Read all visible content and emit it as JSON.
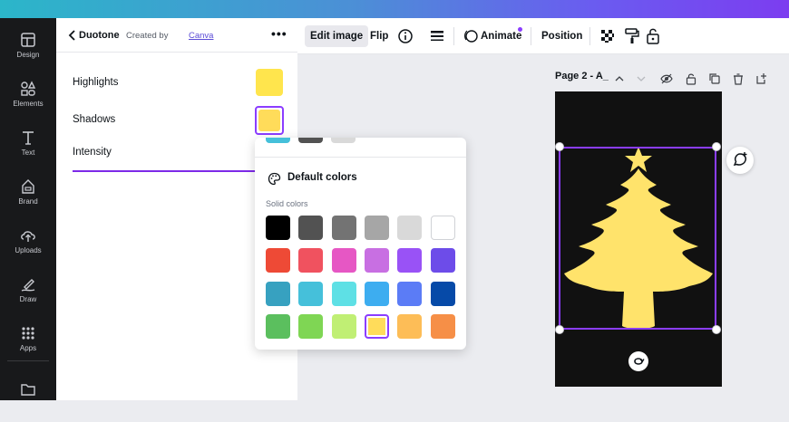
{
  "rail": {
    "items": [
      {
        "label": "Design"
      },
      {
        "label": "Elements"
      },
      {
        "label": "Text"
      },
      {
        "label": "Brand"
      },
      {
        "label": "Uploads"
      },
      {
        "label": "Draw"
      },
      {
        "label": "Apps"
      }
    ]
  },
  "panel": {
    "title": "Duotone",
    "created_by": "Created by",
    "created_by_link": "Canva",
    "rows": {
      "highlights": {
        "label": "Highlights",
        "color": "#ffe54d"
      },
      "shadows": {
        "label": "Shadows",
        "color": "#ffdc5a"
      },
      "intensity": {
        "label": "Intensity"
      }
    }
  },
  "toolbar": {
    "edit_image": "Edit image",
    "flip": "Flip",
    "animate": "Animate",
    "position": "Position"
  },
  "page": {
    "label": "Page 2 - A_"
  },
  "popup": {
    "title": "Default colors",
    "subtitle": "Solid colors",
    "rows": [
      [
        "#000000",
        "#525252",
        "#737373",
        "#a6a6a6",
        "#d9d9d9",
        "#ffffff"
      ],
      [
        "#ee4a36",
        "#f0525f",
        "#e657c4",
        "#c86fe2",
        "#9952f6",
        "#6d4ce9"
      ],
      [
        "#37a1c0",
        "#45c0da",
        "#5ee0e5",
        "#3dadf0",
        "#5b7cf6",
        "#064aa8"
      ],
      [
        "#5bbf5e",
        "#7fd654",
        "#c0ef74",
        "#ffdc5a",
        "#fdbd57",
        "#f68f47"
      ]
    ],
    "selected": "#ffdc5a"
  },
  "colors": {
    "accent": "#8b3dff",
    "tree": "#ffe36b",
    "canvas_bg": "#111111"
  }
}
